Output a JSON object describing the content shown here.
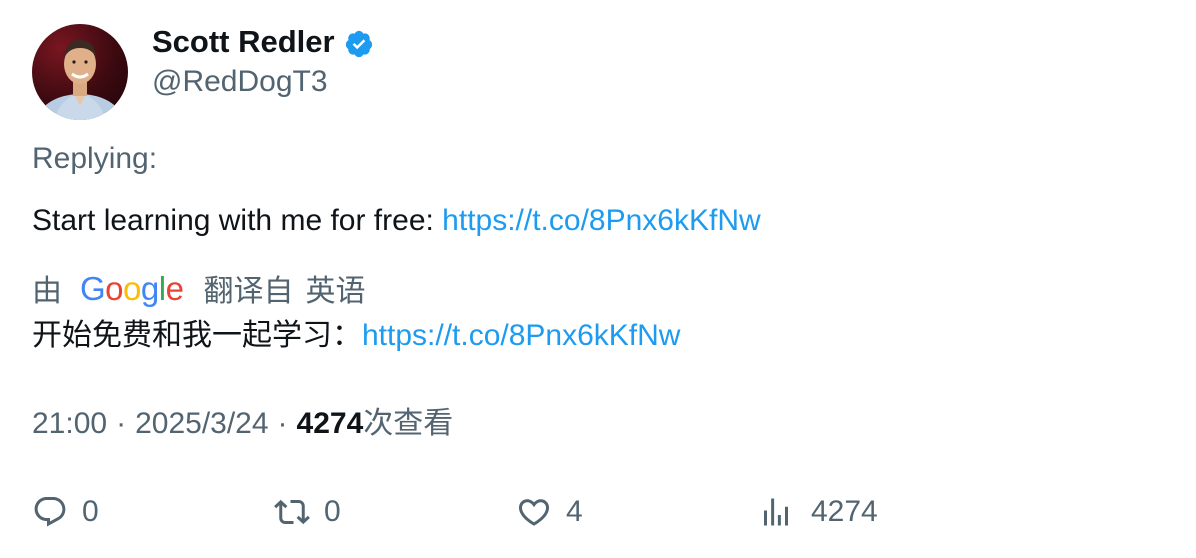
{
  "author": {
    "name": "Scott Redler",
    "handle": "@RedDogT3"
  },
  "replying_label": "Replying:",
  "tweet": {
    "text_prefix": "Start learning with me for free: ",
    "link": "https://t.co/8Pnx6kKfNw"
  },
  "translation": {
    "by_label": "由",
    "provider": "Google",
    "from_label": "翻译自",
    "language": "英语",
    "text_prefix": "开始免费和我一起学习：",
    "link": "https://t.co/8Pnx6kKfNw"
  },
  "meta": {
    "time": "21:00",
    "separator": "·",
    "date": "2025/3/24",
    "views_count": "4274",
    "views_label": "次查看"
  },
  "actions": {
    "replies": "0",
    "retweets": "0",
    "likes": "4",
    "views": "4274"
  },
  "colors": {
    "text": "#0f1419",
    "secondary": "#536471",
    "link": "#1d9bf0",
    "verified": "#1d9bf0"
  }
}
